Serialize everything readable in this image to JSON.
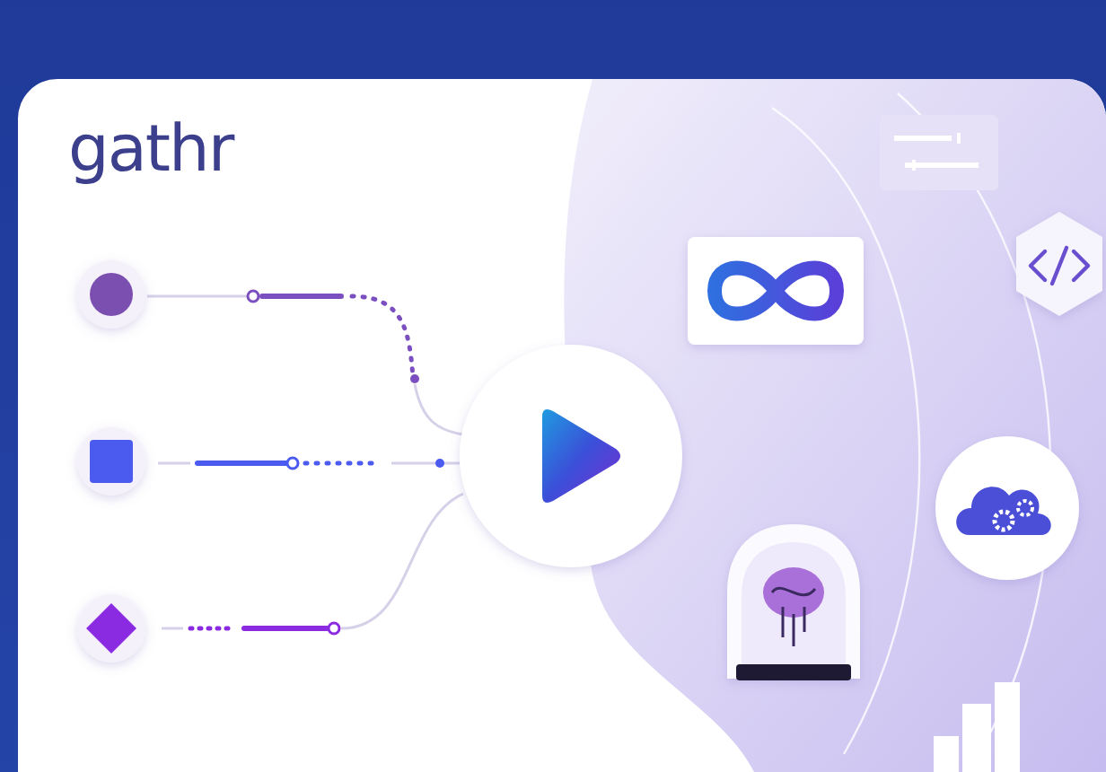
{
  "logo": {
    "text": "gathr"
  }
}
